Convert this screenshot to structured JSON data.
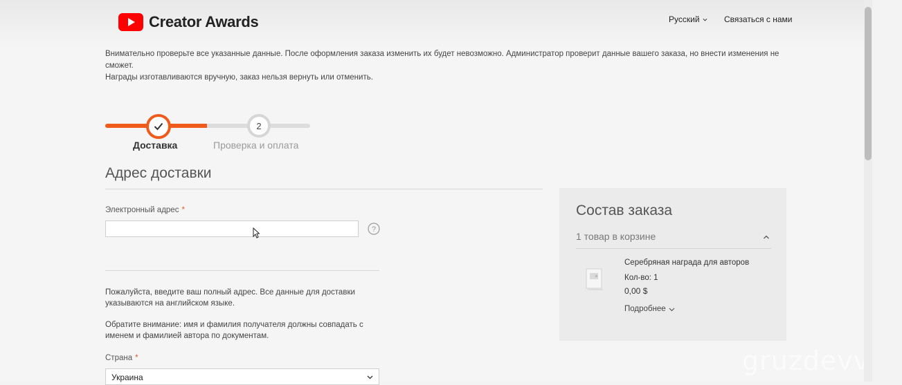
{
  "header": {
    "brand": "Creator Awards",
    "language": "Русский",
    "contact": "Связаться с нами"
  },
  "notice": {
    "line1": "Внимательно проверьте все указанные данные. После оформления заказа изменить их будет невозможно. Администратор проверит данные вашего заказа, но внести изменения не сможет.",
    "line2": "Награды изготавливаются вручную, заказ нельзя вернуть или отменить."
  },
  "stepper": {
    "step1_label": "Доставка",
    "step2_number": "2",
    "step2_label": "Проверка и оплата"
  },
  "form": {
    "section_title": "Адрес доставки",
    "email_label": "Электронный адрес",
    "required_mark": "*",
    "email_value": "",
    "info_text": "Пожалуйста, введите ваш полный адрес. Все данные для доставки указываются на английском языке.",
    "note_text": "Обратите внимание: имя и фамилия получателя должны совпадать с именем и фамилией автора по документам.",
    "country_label": "Страна",
    "country_value": "Украина"
  },
  "summary": {
    "title": "Состав заказа",
    "cart_count": "1 товар в корзине",
    "product_name": "Серебряная награда для авторов",
    "product_qty": "Кол-во: 1",
    "product_price": "0,00 $",
    "details": "Подробнее"
  },
  "watermark": "gruzdevv.ru",
  "colors": {
    "accent": "#f05a1a",
    "brand_red": "#ff0000"
  }
}
